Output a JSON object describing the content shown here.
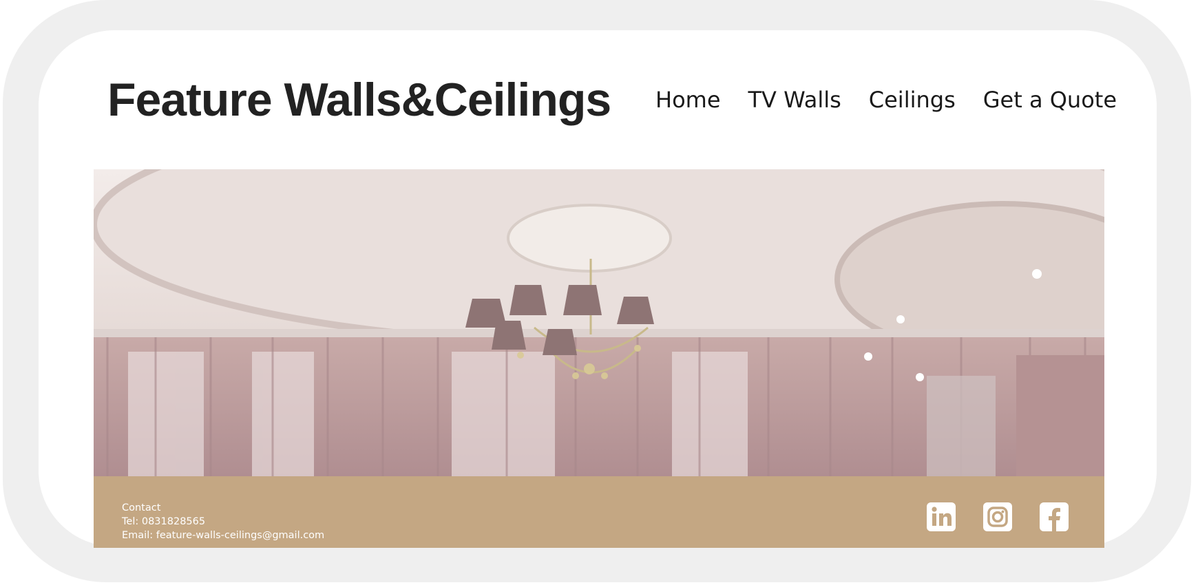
{
  "header": {
    "site_title": "Feature Walls&Ceilings"
  },
  "nav": {
    "items": [
      {
        "label": "Home"
      },
      {
        "label": "TV Walls"
      },
      {
        "label": "Ceilings"
      },
      {
        "label": "Get a Quote"
      }
    ]
  },
  "hero": {
    "image": "ceiling-chandelier-room-photo"
  },
  "footer": {
    "contact_heading": "Contact",
    "tel": "Tel: 0831828565",
    "email": "Email: feature-walls-ceilings@gmail.com",
    "socials": [
      {
        "icon": "linkedin-icon"
      },
      {
        "icon": "instagram-icon"
      },
      {
        "icon": "facebook-icon"
      }
    ]
  },
  "colors": {
    "footer_bg": "#c4a783",
    "frame": "#efefef",
    "title": "#222222"
  }
}
